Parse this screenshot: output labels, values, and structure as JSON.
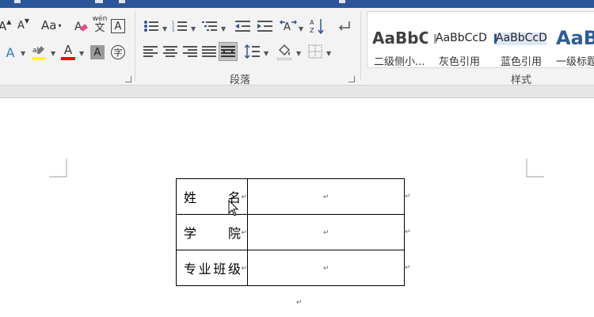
{
  "toolbar": {
    "font_group": {
      "grow_font": "A",
      "shrink_font": "A",
      "change_case": "Aa",
      "phonetic": "wén",
      "phonetic_char": "文",
      "border_char": "A",
      "text_effect": "A",
      "font_color": "A",
      "shading": "A",
      "enclose_char": "字"
    },
    "paragraph_group": {
      "label": "段落",
      "sort_label": "A Z"
    },
    "styles_group": {
      "label": "样式",
      "styles": [
        {
          "sample": "AaBbC",
          "name": "二级侧小..."
        },
        {
          "sample": "AaBbCcD",
          "name": "灰色引用"
        },
        {
          "sample": "AaBbCcD",
          "name": "蓝色引用"
        },
        {
          "sample": "AaB",
          "name": "一级标题"
        }
      ]
    }
  },
  "document": {
    "rows": [
      {
        "label": [
          "姓",
          "名"
        ],
        "value": ""
      },
      {
        "label": [
          "学",
          "院"
        ],
        "value": ""
      },
      {
        "label": [
          "专",
          "业",
          "班",
          "级"
        ],
        "value": ""
      }
    ],
    "paragraph_mark": "↵"
  },
  "colors": {
    "title_bar": "#2b579a",
    "ribbon_bg": "#f3f3f3",
    "highlight": "#ffff00",
    "font_color_bar": "#ff0000",
    "style_heading": "#2e5c9a",
    "blue_quote_bg": "#dce6f4"
  }
}
